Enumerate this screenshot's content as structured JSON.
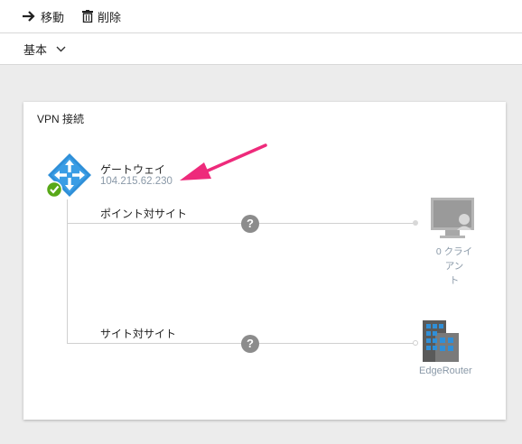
{
  "toolbar": {
    "move_label": "移動",
    "delete_label": "削除"
  },
  "essentials": {
    "label": "基本"
  },
  "vpn": {
    "title": "VPN 接続",
    "gateway": {
      "name": "ゲートウェイ",
      "ip": "104.215.62.230",
      "status": "succeeded"
    },
    "point_to_site": {
      "label": "ポイント対サイト",
      "help": "?",
      "clients_line1": "0 クライアン",
      "clients_line2": "ト"
    },
    "site_to_site": {
      "label": "サイト対サイト",
      "help": "?",
      "device": "EdgeRouter"
    }
  },
  "colors": {
    "gateway_icon": "#2f8fd8",
    "status_ok": "#58a818",
    "callout_arrow": "#ee2a7b",
    "muted_text": "#8a99a8",
    "panel_bg": "#ececec"
  },
  "icons": [
    "arrow-right-icon",
    "trash-icon",
    "chevron-down-icon",
    "gateway-icon",
    "check-badge-icon",
    "help-icon",
    "monitor-icon",
    "building-icon"
  ]
}
